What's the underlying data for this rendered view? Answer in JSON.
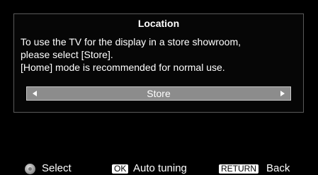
{
  "dialog": {
    "title": "Location",
    "lines": [
      "To use the TV for the display in a store showroom,",
      "please select [Store].",
      "[Home] mode is recommended for normal use."
    ],
    "selector": {
      "value": "Store"
    }
  },
  "footer": {
    "select_label": "Select",
    "ok_key": "OK",
    "ok_label": "Auto tuning",
    "return_key": "RETURN",
    "return_label": "Back"
  },
  "icons": {
    "dpad": "dpad-icon",
    "left": "left-arrow-icon",
    "right": "right-arrow-icon"
  }
}
